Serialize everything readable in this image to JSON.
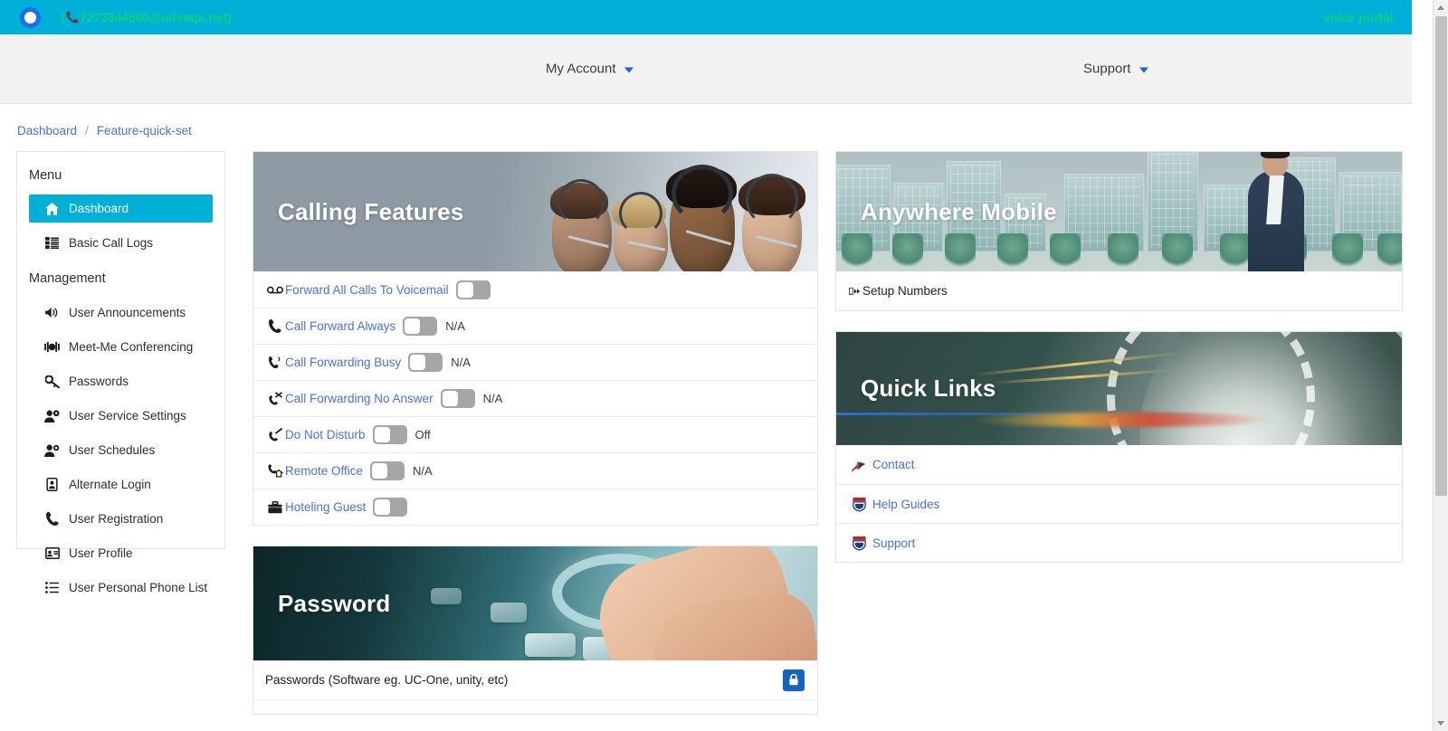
{
  "topbar": {
    "logo_icon": "circle-logo-icon",
    "account_prefix": "(",
    "account_phone_icon": "phone-icon",
    "account": "7273344500@odinapi.net)",
    "brand": "voice portal",
    "brand_color": "#12d07a",
    "bar_color": "#00b0d7"
  },
  "nav": {
    "my_account": "My Account",
    "support": "Support",
    "caret_icon": "chevron-down-icon"
  },
  "breadcrumb": {
    "root": "Dashboard",
    "separator": "/",
    "current": "Feature-quick-set"
  },
  "sidebar": {
    "menu_heading": "Menu",
    "management_heading": "Management",
    "menu_items": [
      {
        "label": "Dashboard",
        "icon": "home-icon",
        "active": true
      },
      {
        "label": "Basic Call Logs",
        "icon": "list-icon",
        "active": false
      }
    ],
    "management_items": [
      {
        "label": "User Announcements",
        "icon": "speaker-icon"
      },
      {
        "label": "Meet-Me Conferencing",
        "icon": "conference-icon"
      },
      {
        "label": "Passwords",
        "icon": "key-icon"
      },
      {
        "label": "User Service Settings",
        "icon": "user-gear-icon"
      },
      {
        "label": "User Schedules",
        "icon": "user-clock-icon"
      },
      {
        "label": "Alternate Login",
        "icon": "id-badge-icon"
      },
      {
        "label": "User Registration",
        "icon": "phone-icon"
      },
      {
        "label": "User Profile",
        "icon": "id-card-icon"
      },
      {
        "label": "User Personal Phone List",
        "icon": "list-icon"
      }
    ]
  },
  "calling_features": {
    "banner_title": "Calling Features",
    "rows": [
      {
        "label": "Forward All Calls To Voicemail",
        "icon": "voicemail-icon",
        "toggle": "off",
        "value": ""
      },
      {
        "label": "Call Forward Always",
        "icon": "phone-icon",
        "toggle": "off",
        "value": "N/A"
      },
      {
        "label": "Call Forwarding Busy",
        "icon": "phone-busy-icon",
        "toggle": "off",
        "value": "N/A"
      },
      {
        "label": "Call Forwarding No Answer",
        "icon": "phone-missed-icon",
        "toggle": "off",
        "value": "N/A"
      },
      {
        "label": "Do Not Disturb",
        "icon": "phone-slash-icon",
        "toggle": "off",
        "value": "Off"
      },
      {
        "label": "Remote Office",
        "icon": "remote-office-icon",
        "toggle": "off",
        "value": "N/A"
      },
      {
        "label": "Hoteling Guest",
        "icon": "briefcase-icon",
        "toggle": "off",
        "value": ""
      }
    ]
  },
  "anywhere_mobile": {
    "banner_title": "Anywhere Mobile",
    "setup_label": "Setup Numbers",
    "setup_icon": "mobile-forward-icon"
  },
  "quick_links": {
    "banner_title": "Quick Links",
    "items": [
      {
        "label": "Contact",
        "icon": "contact-crest-icon"
      },
      {
        "label": "Help Guides",
        "icon": "shield-crest-icon"
      },
      {
        "label": "Support",
        "icon": "shield-crest-icon"
      }
    ]
  },
  "password": {
    "banner_title": "Password",
    "rows": [
      {
        "label": "Passwords (Software eg. UC-One, unity, etc)",
        "action_icon": "lock-icon"
      }
    ]
  },
  "scrollbar": {
    "up_icon": "scroll-up-icon",
    "down_icon": "scroll-down-icon"
  }
}
